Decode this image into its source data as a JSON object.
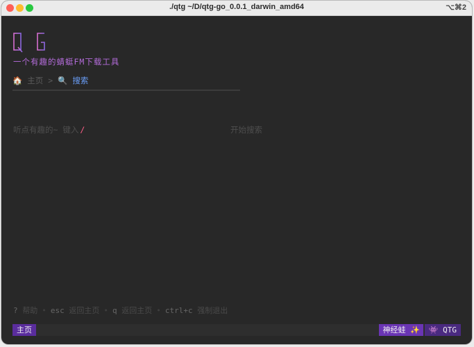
{
  "window": {
    "title": "./qtg  ~/D/qtg-go_0.0.1_darwin_amd64",
    "shortcut": "⌥⌘2"
  },
  "logo": {
    "text": "QTG"
  },
  "tagline": "一个有趣的蜻蜓FM下载工具",
  "breadcrumb": {
    "home_icon": "🏠",
    "home": "主页",
    "separator": ">",
    "search_icon": "🔍",
    "current": "搜索"
  },
  "search": {
    "placeholder": "听点有趣的~ 键入",
    "cursor": "/",
    "start": "开始搜索"
  },
  "help": [
    {
      "key": "?",
      "desc": "帮助"
    },
    {
      "key": "esc",
      "desc": "返回主页"
    },
    {
      "key": "q",
      "desc": "返回主页"
    },
    {
      "key": "ctrl+c",
      "desc": "强制退出"
    }
  ],
  "status": {
    "left": "主页",
    "tag": "神经蛙",
    "tag_icon": "✨",
    "frog_icon": "👾",
    "app": "QTG"
  },
  "colors": {
    "accent": "#5a2d9d",
    "active": "#6a9ef8",
    "cursor": "#ff5f87"
  }
}
